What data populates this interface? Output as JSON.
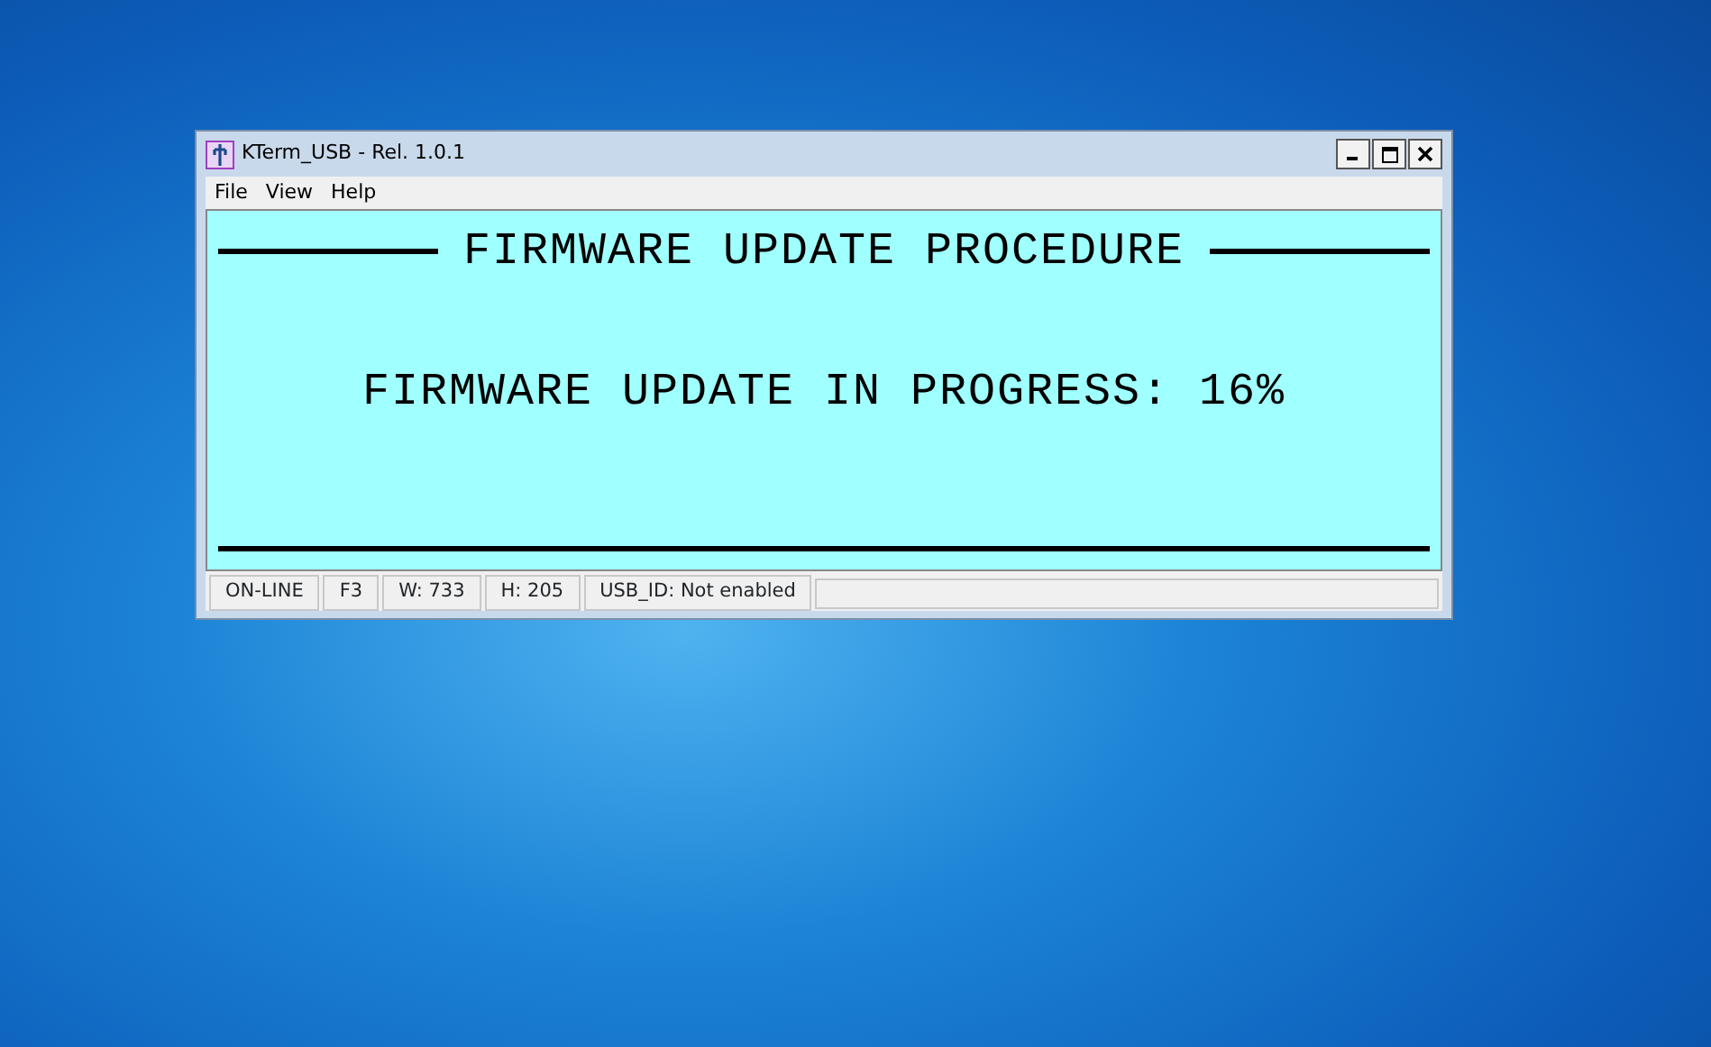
{
  "window": {
    "title": "KTerm_USB - Rel. 1.0.1"
  },
  "menu": [
    "File",
    "View",
    "Help"
  ],
  "terminal": {
    "heading": "FIRMWARE UPDATE PROCEDURE",
    "message": "FIRMWARE UPDATE IN PROGRESS: 16%"
  },
  "status_bar": [
    "ON-LINE",
    "F3",
    "W:  733",
    "H:  205",
    "USB_ID: Not enabled"
  ]
}
